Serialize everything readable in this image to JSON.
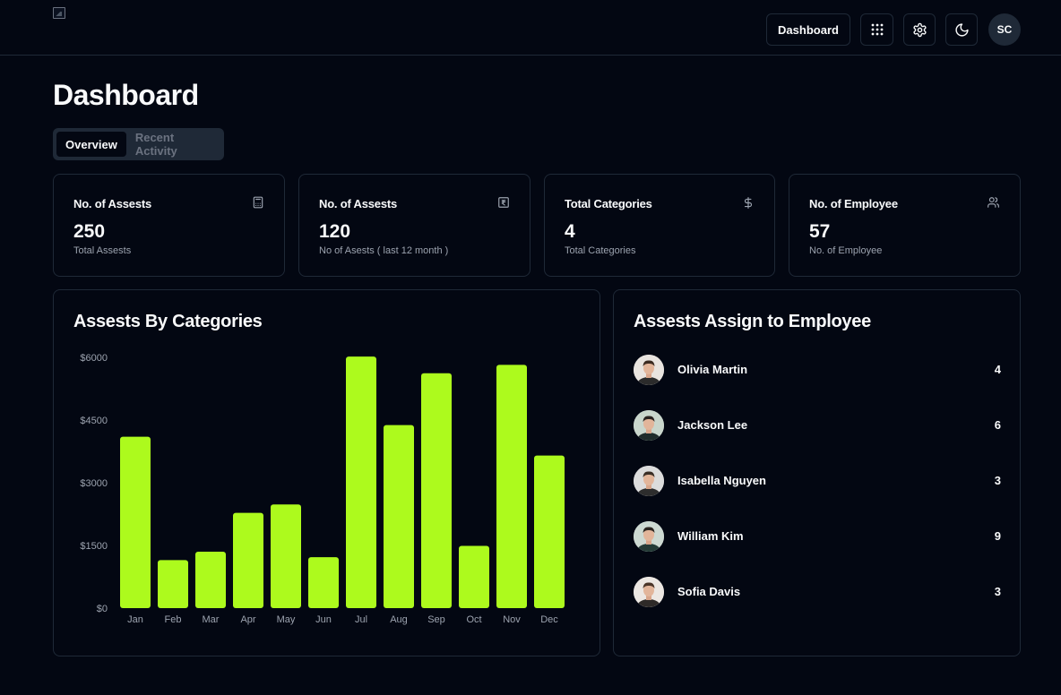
{
  "header": {
    "nav_label": "Dashboard",
    "avatar_initials": "SC"
  },
  "page": {
    "title": "Dashboard",
    "tabs": [
      {
        "label": "Overview",
        "active": true
      },
      {
        "label": "Recent Activity",
        "active": false
      }
    ]
  },
  "stats": [
    {
      "title": "No. of Assests",
      "value": "250",
      "sub": "Total Assests",
      "icon": "calculator-icon"
    },
    {
      "title": "No. of Assests",
      "value": "120",
      "sub": "No of Asests ( last 12 month )",
      "icon": "receipt-icon"
    },
    {
      "title": "Total Categories",
      "value": "4",
      "sub": "Total Categories",
      "icon": "dollar-icon"
    },
    {
      "title": "No. of Employee",
      "value": "57",
      "sub": "No. of Employee",
      "icon": "users-icon"
    }
  ],
  "chart": {
    "heading": "Assests By Categories"
  },
  "chart_data": {
    "type": "bar",
    "categories": [
      "Jan",
      "Feb",
      "Mar",
      "Apr",
      "May",
      "Jun",
      "Jul",
      "Aug",
      "Sep",
      "Oct",
      "Nov",
      "Dec"
    ],
    "values": [
      4100,
      1150,
      1350,
      2280,
      2480,
      1220,
      6020,
      4380,
      5620,
      1490,
      5820,
      3650
    ],
    "yticks": [
      "$0",
      "$1500",
      "$3000",
      "$4500",
      "$6000"
    ],
    "ylim": [
      0,
      6000
    ],
    "bar_color": "#adfa1d",
    "title": "",
    "xlabel": "",
    "ylabel": "",
    "grid": false
  },
  "employees": {
    "heading": "Assests Assign to Employee",
    "items": [
      {
        "name": "Olivia Martin",
        "count": "4"
      },
      {
        "name": "Jackson Lee",
        "count": "6"
      },
      {
        "name": "Isabella Nguyen",
        "count": "3"
      },
      {
        "name": "William Kim",
        "count": "9"
      },
      {
        "name": "Sofia Davis",
        "count": "3"
      }
    ]
  },
  "colors": {
    "background": "#030712",
    "border": "#1f2937",
    "accent": "#adfa1d",
    "muted_text": "#9ca3af"
  }
}
